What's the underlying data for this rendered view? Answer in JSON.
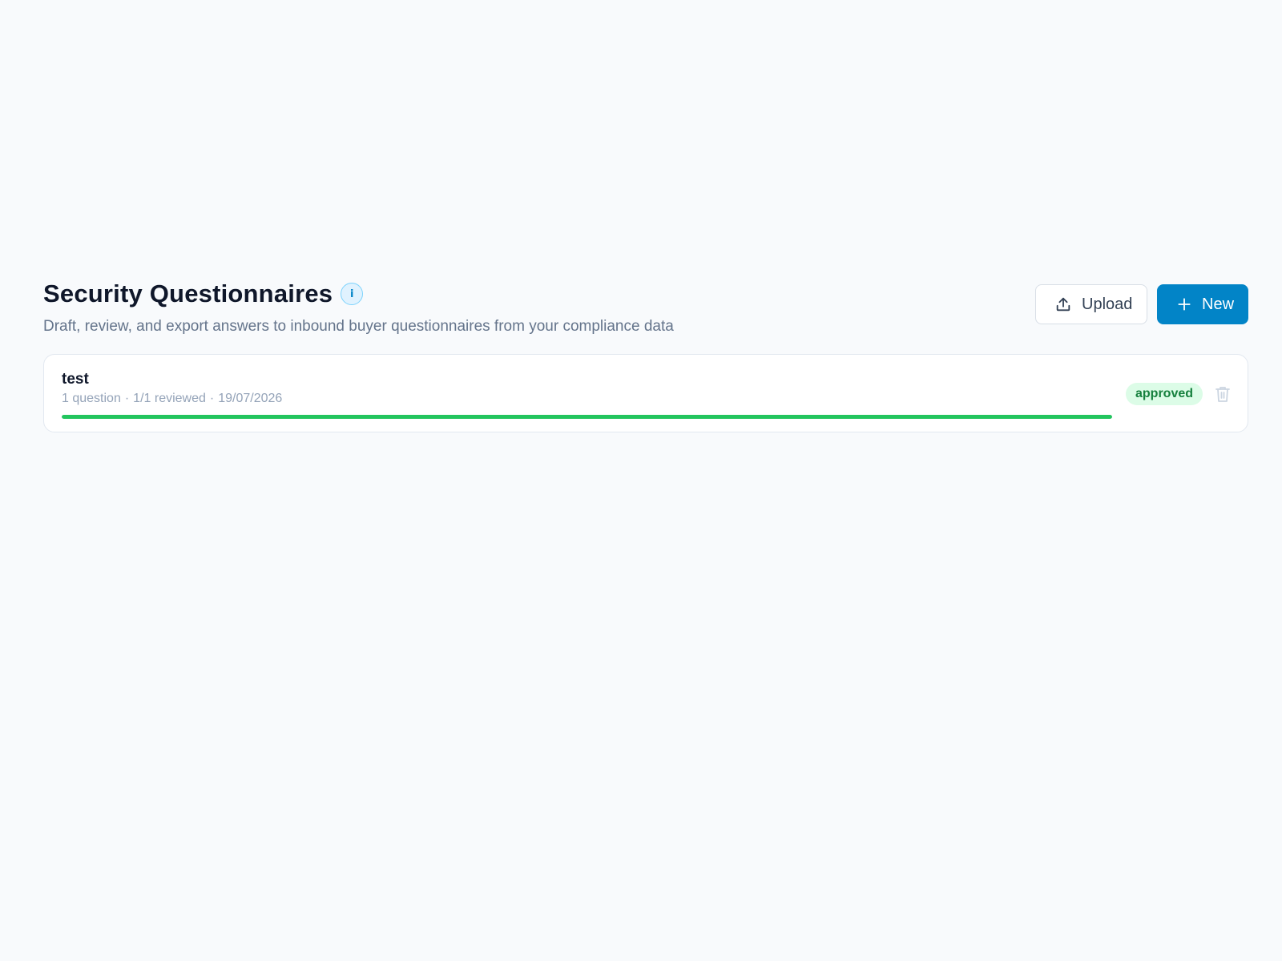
{
  "header": {
    "title": "Security Questionnaires",
    "info_icon": "info-icon",
    "subtitle": "Draft, review, and export answers to inbound buyer questionnaires from your compliance data"
  },
  "actions": {
    "upload_label": "Upload",
    "upload_icon": "upload-icon",
    "new_label": "New",
    "new_icon": "plus-icon"
  },
  "questionnaires": [
    {
      "name": "test",
      "question_count": "1 question",
      "reviewed": "1/1 reviewed",
      "date": "19/07/2026",
      "separator": "·",
      "progress_percent": 100,
      "status": "approved",
      "delete_icon": "trash-icon"
    }
  ],
  "colors": {
    "background": "#f8fafc",
    "accent": "#0284c7",
    "progress": "#22c55e",
    "status_approved_bg": "#dcfce7",
    "status_approved_text": "#15803d"
  }
}
